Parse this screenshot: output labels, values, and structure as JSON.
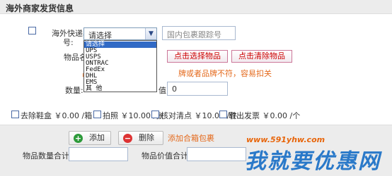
{
  "header": {
    "title": "海外商家发货信息"
  },
  "tracking": {
    "label_line1": "海外快递单",
    "label_line2": "号:",
    "select_value": "请选择",
    "domestic_placeholder": "国内包裹跟踪号",
    "options": [
      "请选择",
      "UPS",
      "USPS",
      "ONTRAC",
      "FedEx",
      "DHL",
      "EMS",
      "其 他"
    ],
    "selected_index": 0
  },
  "goods": {
    "label": "物品名称:",
    "pick_button": "点击选择物品",
    "clear_button": "点击清除物品",
    "warning_partial": "牌或者品牌不符，容易扣关",
    "left_mark": "品",
    "qty_label": "数量:",
    "value_label_partial": "值:",
    "value_input": "0"
  },
  "fees": [
    {
      "label": "去除鞋盒 ￥0.00 /箱",
      "checked": false
    },
    {
      "label": "拍照 ￥10.00 /张",
      "checked": false
    },
    {
      "label": "核对清点 ￥10.00 /件",
      "checked": false
    },
    {
      "label": "取出发票 ￥0.00 /个",
      "checked": false
    }
  ],
  "bottom": {
    "add_button": "添加",
    "delete_button": "删除",
    "add_combined": "添加合箱包裹",
    "qty_total_label": "物品数量合计:",
    "value_total_label": "物品价值合计:"
  },
  "watermark": {
    "url": "www.591yhw.com",
    "text": "我就要优惠网"
  }
}
